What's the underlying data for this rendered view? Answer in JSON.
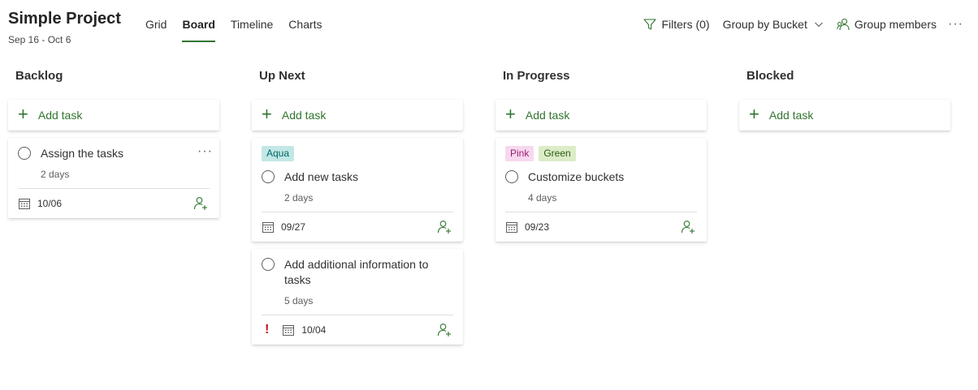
{
  "header": {
    "title": "Simple Project",
    "dates": "Sep 16 - Oct 6",
    "tabs": [
      {
        "label": "Grid",
        "active": false
      },
      {
        "label": "Board",
        "active": true
      },
      {
        "label": "Timeline",
        "active": false
      },
      {
        "label": "Charts",
        "active": false
      }
    ],
    "filters_label": "Filters (0)",
    "group_by_label": "Group by Bucket",
    "group_members_label": "Group members",
    "more_label": "···"
  },
  "add_task_label": "Add task",
  "colors": {
    "accent": "#31752f",
    "aqua_bg": "#c2e7e6",
    "aqua_fg": "#006666",
    "pink_bg": "#f7d9ef",
    "pink_fg": "#9b1d74",
    "green_bg": "#dbecc7",
    "green_fg": "#2d5a12",
    "priority": "#c50f1f"
  },
  "columns": [
    {
      "title": "Backlog",
      "cards": [
        {
          "title": "Assign the tasks",
          "duration": "2 days",
          "due": "10/06",
          "labels": [],
          "more": "···"
        }
      ]
    },
    {
      "title": "Up Next",
      "cards": [
        {
          "title": "Add new tasks",
          "duration": "2 days",
          "due": "09/27",
          "labels": [
            "Aqua"
          ]
        },
        {
          "title": "Add additional information to tasks",
          "duration": "5 days",
          "due": "10/04",
          "labels": [],
          "priority": "!"
        }
      ]
    },
    {
      "title": "In Progress",
      "cards": [
        {
          "title": "Customize buckets",
          "duration": "4 days",
          "due": "09/23",
          "labels": [
            "Pink",
            "Green"
          ]
        }
      ]
    },
    {
      "title": "Blocked",
      "cards": []
    }
  ]
}
